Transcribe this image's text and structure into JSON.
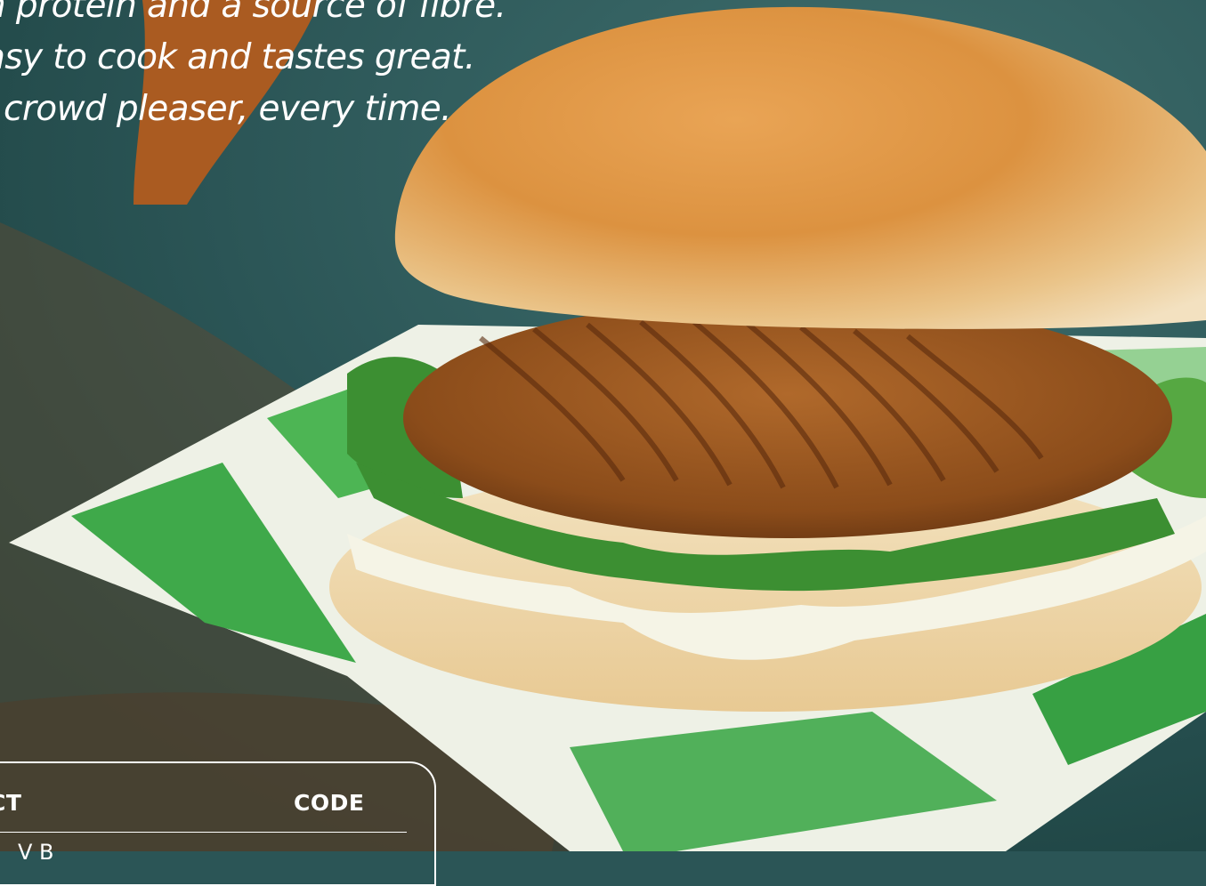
{
  "hero": {
    "tagline_lines": [
      "n protein and a source of fibre.",
      "asy to cook and tastes great.",
      "l crowd pleaser, every time."
    ],
    "image": "veggie-burger-photo"
  },
  "product_table": {
    "columns": [
      "CT",
      "CODE"
    ],
    "first_row_fragment": "V    B"
  },
  "colors": {
    "background": "#2b5556",
    "accent_orange": "#b85c1c",
    "wrapper_green": "#3fa94a",
    "text": "#ffffff"
  }
}
